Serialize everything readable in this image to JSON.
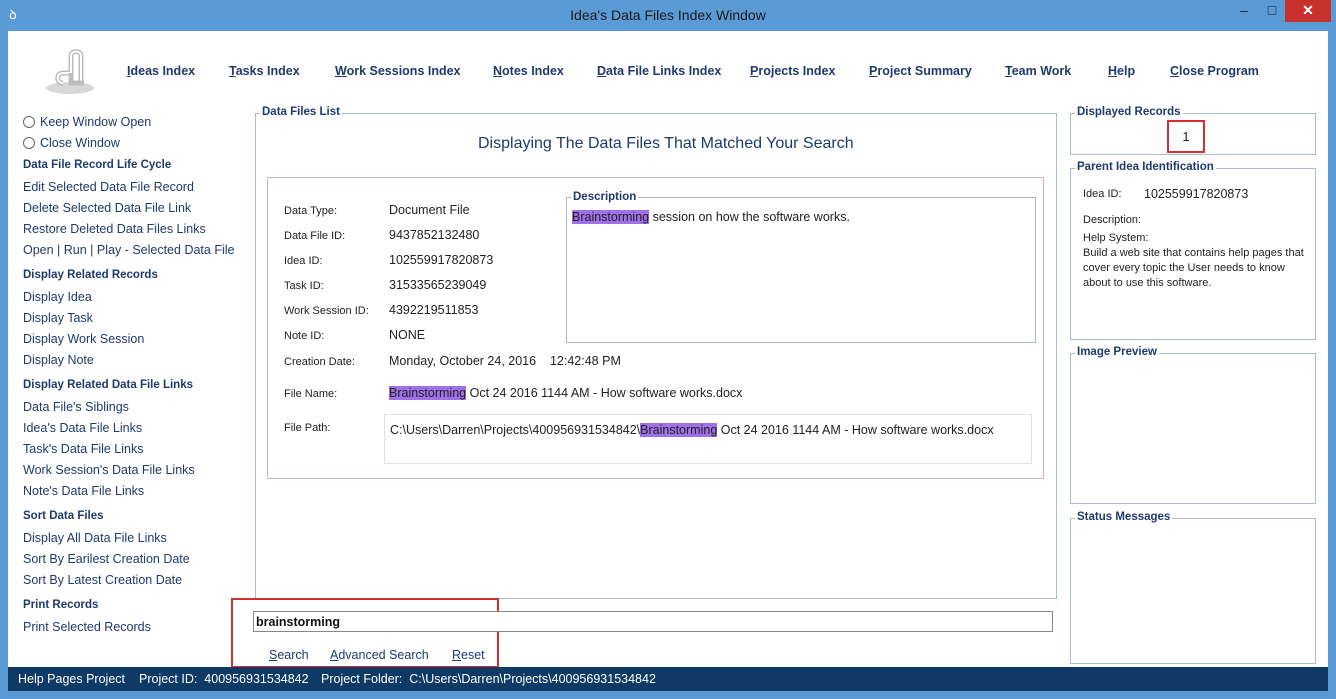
{
  "window": {
    "title": "Idea's Data Files Index Window",
    "minimize": "–",
    "maximize": "□",
    "close": "✕"
  },
  "nav": [
    "Ideas Index",
    "Tasks Index",
    "Work Sessions Index",
    "Notes Index",
    "Data File Links Index",
    "Projects Index",
    "Project Summary",
    "Team Work",
    "Help",
    "Close Program"
  ],
  "sidebar": {
    "radio_keep": "Keep Window Open",
    "radio_close": "Close Window",
    "sections": [
      {
        "title": "Data File Record Life Cycle",
        "items": [
          "Edit Selected Data File Record",
          "Delete Selected Data File Link",
          "Restore Deleted Data Files Links",
          "Open | Run | Play - Selected Data File"
        ]
      },
      {
        "title": "Display Related Records",
        "items": [
          "Display Idea",
          "Display Task",
          "Display Work Session",
          "Display Note"
        ]
      },
      {
        "title": "Display Related Data File Links",
        "items": [
          "Data File's Siblings",
          "Idea's Data File Links",
          "Task's Data File Links",
          "Work Session's Data File Links",
          "Note's Data File Links"
        ]
      },
      {
        "title": "Sort Data Files",
        "items": [
          "Display All Data File Links",
          "Sort By Earilest Creation Date",
          "Sort By Latest Creation Date"
        ]
      },
      {
        "title": "Print Records",
        "items": [
          "Print Selected Records"
        ]
      }
    ]
  },
  "main": {
    "group_title": "Data Files List",
    "heading": "Displaying The Data Files That Matched Your Search",
    "fields": [
      {
        "label": "Data Type:",
        "value": "Document File"
      },
      {
        "label": "Data File ID:",
        "value": "9437852132480"
      },
      {
        "label": "Idea ID:",
        "value": "102559917820873"
      },
      {
        "label": "Task ID:",
        "value": "31533565239049"
      },
      {
        "label": "Work Session ID:",
        "value": "4392219511853"
      },
      {
        "label": "Note ID:",
        "value": "NONE"
      },
      {
        "label": "Creation Date:",
        "value": "Monday, October 24, 2016    12:42:48 PM"
      }
    ],
    "file_name_label": "File Name:",
    "file_name_hl": "Brainstorming",
    "file_name_rest": " Oct 24 2016 1144 AM - How software works.docx",
    "file_path_label": "File Path:",
    "file_path_pre": "C:\\Users\\Darren\\Projects\\400956931534842\\",
    "file_path_hl": "Brainstorming",
    "file_path_rest": " Oct 24 2016 1144 AM - How software works.docx",
    "desc_title": "Description",
    "desc_hl": "Brainstorming",
    "desc_rest": " session on how the software works."
  },
  "search": {
    "value": "brainstorming",
    "search": "Search",
    "advanced": "Advanced Search",
    "reset": "Reset"
  },
  "right": {
    "displayed_title": "Displayed Records",
    "displayed_count": "1",
    "parent_title": "Parent Idea Identification",
    "idea_id_label": "Idea ID:",
    "idea_id_value": "102559917820873",
    "description_label": "Description:",
    "desc_lines": [
      "Help System:",
      "Build a web site that contains help pages that",
      "cover every topic the User needs to know",
      "about to use this software."
    ],
    "image_title": "Image Preview",
    "status_title": "Status Messages"
  },
  "statusbar": {
    "project": "Help Pages Project",
    "project_id": "Project ID:  400956931534842",
    "folder": "Project Folder:  C:\\Users\\Darren\\Projects\\400956931534842"
  }
}
